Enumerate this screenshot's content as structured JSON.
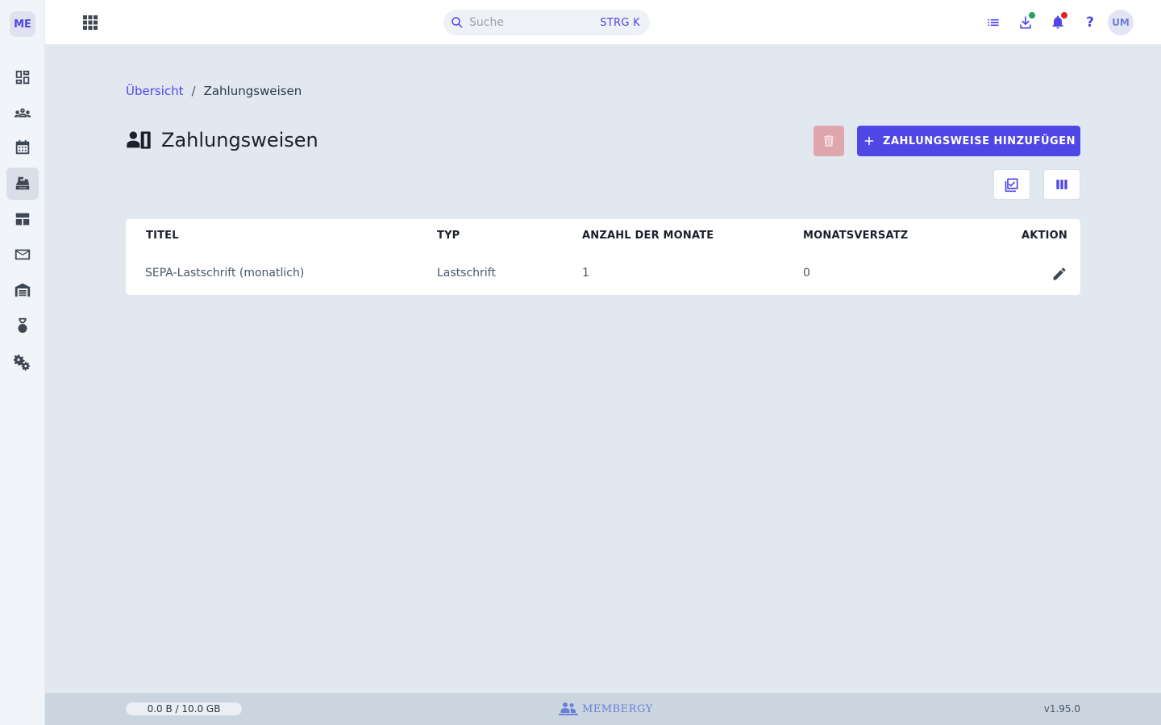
{
  "app": {
    "logo_initials": "ME",
    "accent_color": "#4f46e5",
    "danger_color": "#e0a6ae"
  },
  "sidebar": {
    "items": [
      {
        "icon": "dashboard-icon",
        "active": false
      },
      {
        "icon": "members-icon",
        "active": false
      },
      {
        "icon": "calendar-icon",
        "active": false
      },
      {
        "icon": "cash-register-icon",
        "active": true
      },
      {
        "icon": "table-view-icon",
        "active": false
      },
      {
        "icon": "mail-icon",
        "active": false
      },
      {
        "icon": "warehouse-icon",
        "active": false
      },
      {
        "icon": "award-icon",
        "active": false
      },
      {
        "icon": "settings-icon",
        "active": false
      }
    ]
  },
  "topbar": {
    "search": {
      "placeholder": "Suche",
      "shortcut": "STRG K"
    },
    "icons": [
      "tasks-icon",
      "download-icon",
      "notifications-icon",
      "help-icon"
    ],
    "help_label": "?",
    "avatar_initials": "UM"
  },
  "breadcrumb": {
    "parent": "Übersicht",
    "separator": "/",
    "current": "Zahlungsweisen"
  },
  "page": {
    "title": "Zahlungsweisen",
    "add_button_label": "ZAHLUNGSWEISE HINZUFÜGEN"
  },
  "table": {
    "headers": [
      "TITEL",
      "TYP",
      "ANZAHL DER MONATE",
      "MONATSVERSATZ",
      "AKTION"
    ],
    "rows": [
      {
        "titel": "SEPA-Lastschrift (monatlich)",
        "typ": "Lastschrift",
        "anzahl_monate": "1",
        "monatsversatz": "0"
      }
    ]
  },
  "footer": {
    "storage": "0.0 B / 10.0 GB",
    "brand": "MEMBERGY",
    "version": "v1.95.0"
  }
}
